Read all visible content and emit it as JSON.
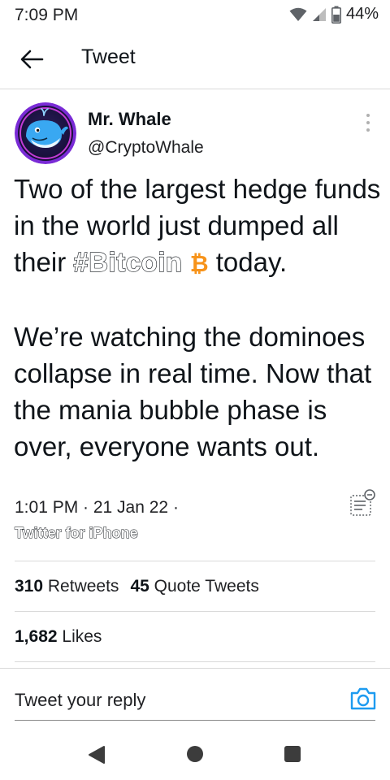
{
  "status_bar": {
    "time": "7:09 PM",
    "battery_percent": "44%",
    "icons": [
      "wifi-icon",
      "cell-signal-icon",
      "battery-icon"
    ]
  },
  "header": {
    "back_icon": "back-arrow-icon",
    "title": "Tweet"
  },
  "tweet": {
    "author_name": "Mr. Whale",
    "author_handle": "@CryptoWhale",
    "avatar_icon": "whale-avatar",
    "more_icon": "more-vertical-icon",
    "text_part1": "Two of the largest hedge funds in the world just dumped all their ",
    "hashtag": "#Bitcoin",
    "emoji_symbol": "₿",
    "text_part2": " today.",
    "paragraph2": "We’re watching the dominoes collapse in real time. Now that the mania bubble phase is over, everyone wants out.",
    "timestamp": "1:01 PM · 21 Jan 22 ·",
    "client": "Twitter for iPhone",
    "translate_icon": "translate-icon"
  },
  "stats": {
    "retweets_count": "310",
    "retweets_label": "Retweets",
    "quotes_count": "45",
    "quotes_label": "Quote Tweets",
    "likes_count": "1,682",
    "likes_label": "Likes"
  },
  "reply": {
    "placeholder": "Tweet your reply",
    "camera_icon": "camera-icon"
  },
  "nav": {
    "icons": [
      "nav-back-icon",
      "nav-home-icon",
      "nav-recents-icon"
    ]
  },
  "colors": {
    "accent": "#1d9bf0",
    "bitcoin": "#f7931a",
    "text": "#0f1419",
    "divider": "#d9d9d9"
  }
}
